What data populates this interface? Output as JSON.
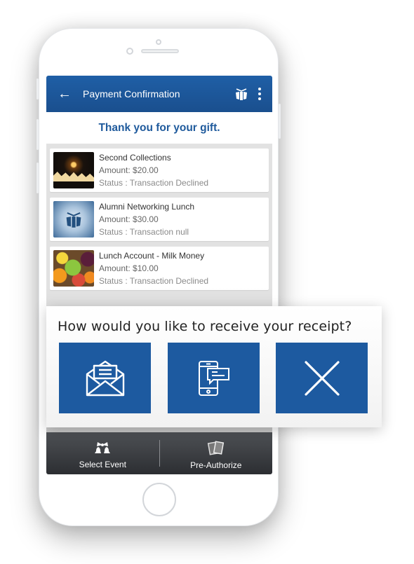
{
  "app": {
    "title": "Payment Confirmation",
    "back_icon": "arrow-left-icon",
    "brand_icon": "gift-logo-icon",
    "menu_icon": "more-vertical-icon"
  },
  "banner": "Thank you for your gift.",
  "transactions": [
    {
      "name": "Second Collections",
      "amount": "Amount: $20.00",
      "status": "Status : Transaction Declined",
      "image": "candle-image"
    },
    {
      "name": "Alumni Networking Lunch",
      "amount": "Amount: $30.00",
      "status": "Status : Transaction null",
      "image": "logo-image"
    },
    {
      "name": "Lunch Account - Milk Money",
      "amount": "Amount: $10.00",
      "status": "Status : Transaction Declined",
      "image": "fruit-image"
    }
  ],
  "bottom_nav": [
    {
      "label": "Select Event",
      "icon": "bells-icon"
    },
    {
      "label": "Pre-Authorize",
      "icon": "cards-icon"
    }
  ],
  "receipt_dialog": {
    "question": "How would you like to receive your receipt?",
    "options": [
      {
        "id": "email",
        "icon": "envelope-icon"
      },
      {
        "id": "sms",
        "icon": "phone-message-icon"
      },
      {
        "id": "none",
        "icon": "close-icon"
      }
    ]
  },
  "colors": {
    "primary": "#1d5aa0",
    "appbar": "#1f5fa6",
    "banner_text": "#1f5a9c",
    "bottom_bar": "#3a3c40"
  }
}
